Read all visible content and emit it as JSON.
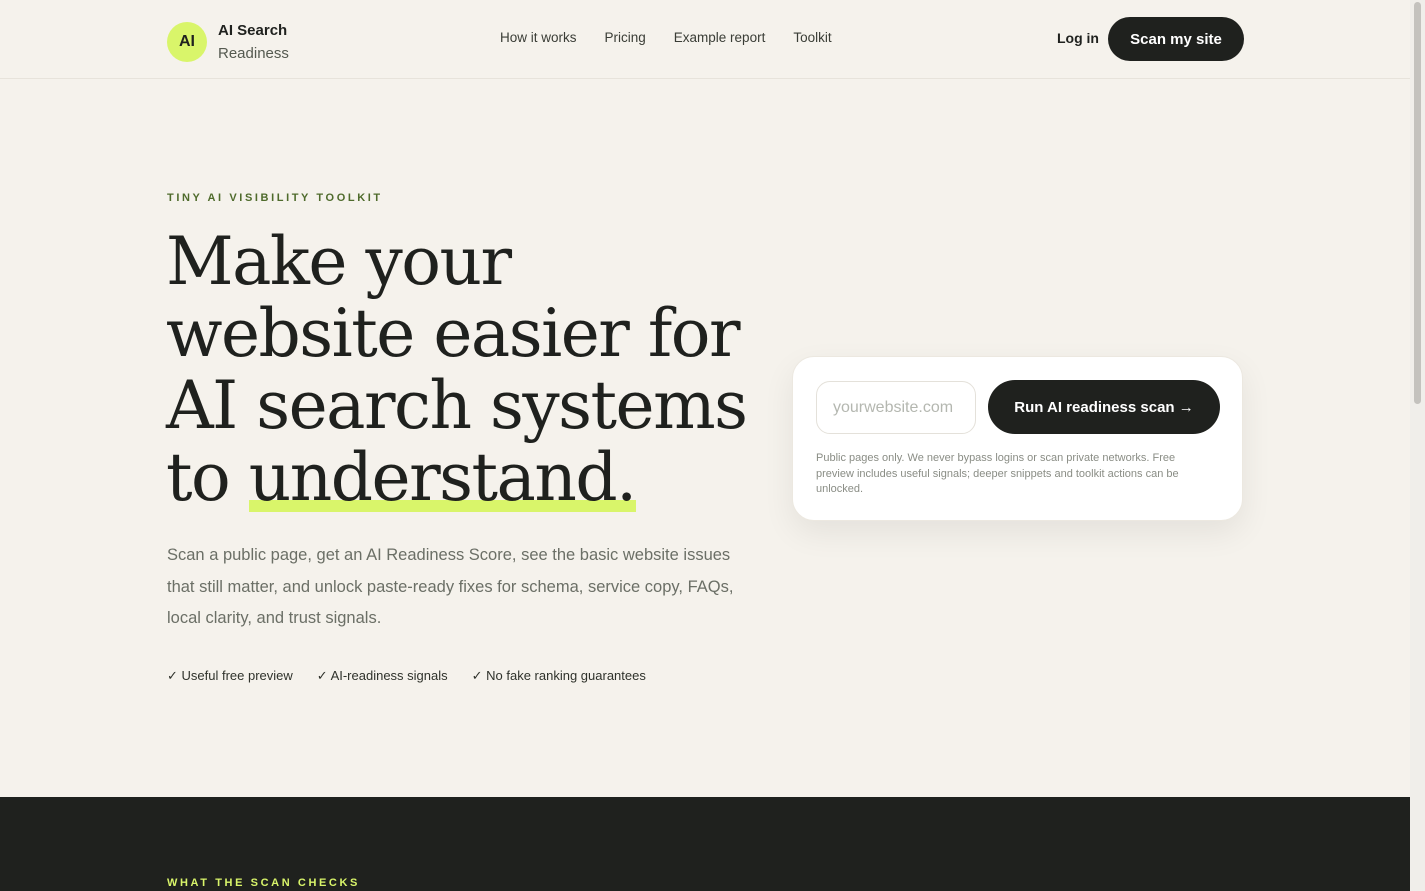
{
  "brand": {
    "badge": "AI",
    "line1": "AI Search",
    "line2": "Readiness"
  },
  "nav": {
    "items": [
      "How it works",
      "Pricing",
      "Example report",
      "Toolkit"
    ]
  },
  "header": {
    "login_label": "Log in",
    "cta_label": "Scan my site"
  },
  "hero": {
    "eyebrow": "TINY AI VISIBILITY TOOLKIT",
    "headline_line1": "Make your",
    "headline_line2": "website easier for",
    "headline_line3": "AI search systems",
    "headline_line4_prefix": "to ",
    "headline_line4_highlight": "understand.",
    "lead": "Scan a public page, get an AI Readiness Score, see the basic website issues that still matter, and unlock paste-ready fixes for schema, service copy, FAQs, local clarity, and trust signals.",
    "checks": [
      "✓ Useful free preview",
      "✓ AI-readiness signals",
      "✓ No fake ranking guarantees"
    ]
  },
  "scan_card": {
    "url_placeholder": "yourwebsite.com",
    "url_value": "",
    "run_label": "Run AI readiness scan →",
    "note": "Public pages only. We never bypass logins or scan private networks. Free preview includes useful signals; deeper snippets and toolkit actions can be unlocked."
  },
  "next_section": {
    "eyebrow": "WHAT THE SCAN CHECKS"
  },
  "colors": {
    "accent": "#d9f56a",
    "dark": "#1f211e",
    "background": "#f5f2ec"
  }
}
